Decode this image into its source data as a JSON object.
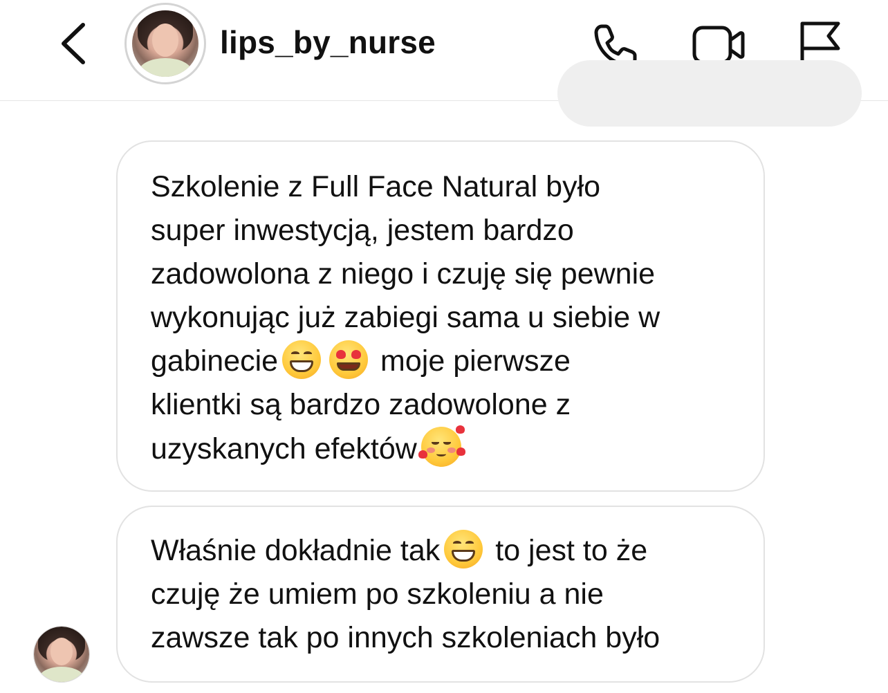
{
  "header": {
    "username": "lips_by_nurse",
    "icons": {
      "back": "chevron-left-icon",
      "phone": "phone-icon",
      "video": "video-camera-icon",
      "flag": "flag-icon"
    }
  },
  "messages": [
    {
      "segments": [
        {
          "type": "text",
          "value": "Szkolenie z Full Face Natural było\nsuper inwestycją, jestem bardzo\nzadowolona z niego i czuję się pewnie\nwykonując już zabiegi sama u siebie w\ngabinecie"
        },
        {
          "type": "emoji",
          "value": "grinning-face-with-smiling-eyes"
        },
        {
          "type": "emoji",
          "value": "smiling-face-with-heart-eyes"
        },
        {
          "type": "text",
          "value": " moje pierwsze\nklientki są bardzo zadowolone z\nuzyskanych efektów"
        },
        {
          "type": "emoji",
          "value": "smiling-face-with-hearts"
        }
      ]
    },
    {
      "segments": [
        {
          "type": "text",
          "value": "Właśnie dokładnie tak"
        },
        {
          "type": "emoji",
          "value": "grinning-face-with-smiling-eyes"
        },
        {
          "type": "text",
          "value": " to jest to że\nczuję że umiem po szkoleniu a nie\nzawsze tak po innych szkoleniach było"
        }
      ]
    }
  ],
  "colors": {
    "bubble_border": "#e2e2e2",
    "own_bubble_bg": "#efefef",
    "text": "#111111"
  }
}
